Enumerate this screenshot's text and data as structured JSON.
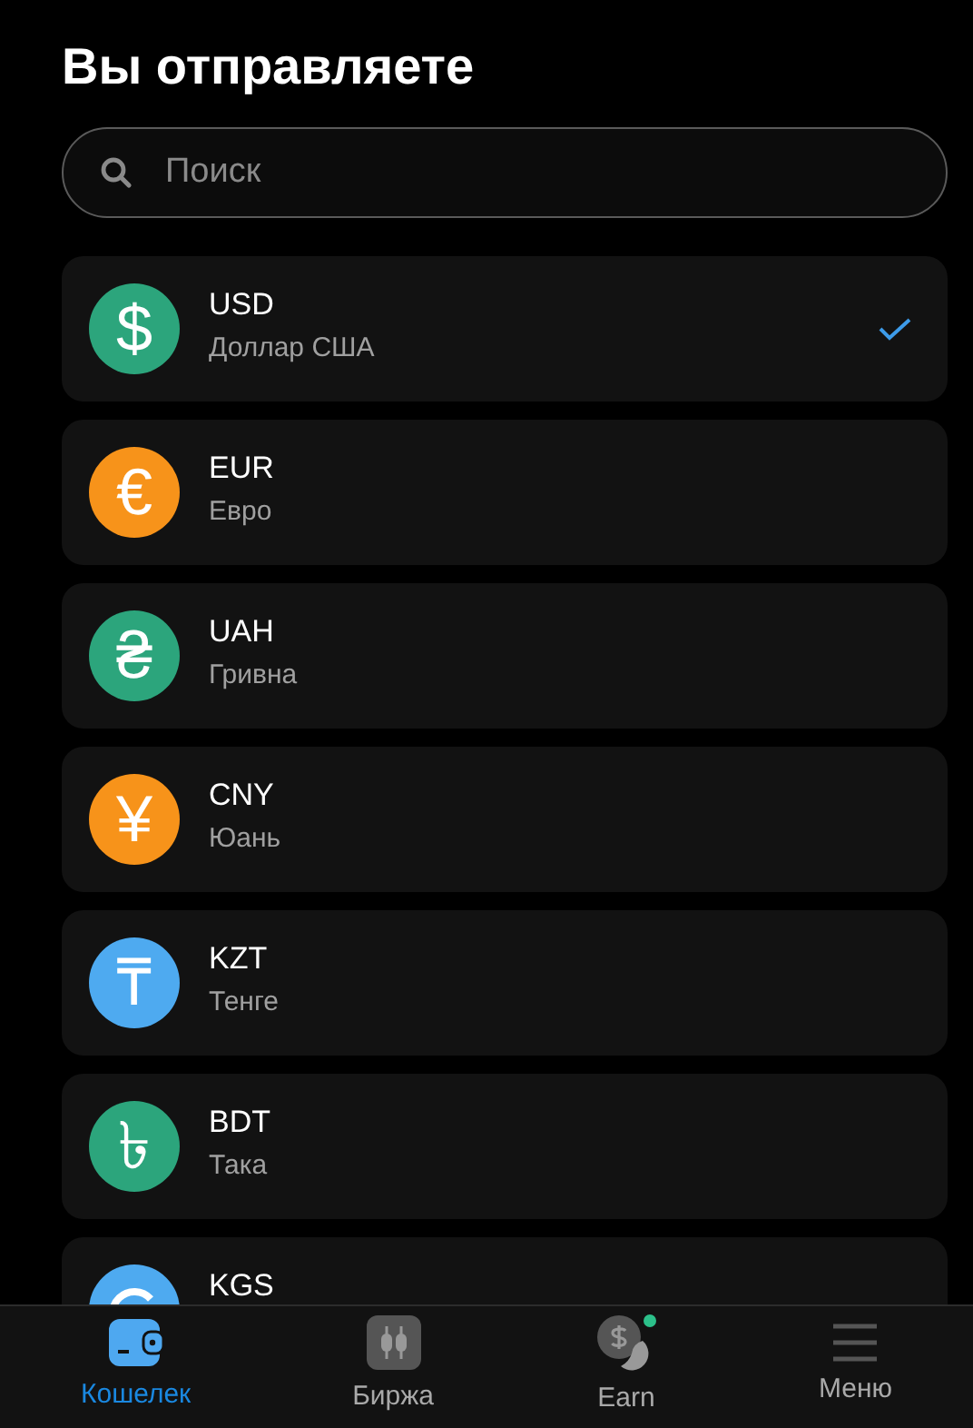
{
  "title": "Вы отправляете",
  "search": {
    "placeholder": "Поиск"
  },
  "currencies": [
    {
      "code": "USD",
      "name": "Доллар США",
      "symbol": "$",
      "color": "#2ca57c",
      "selected": true
    },
    {
      "code": "EUR",
      "name": "Евро",
      "symbol": "€",
      "color": "#f7931a",
      "selected": false
    },
    {
      "code": "UAH",
      "name": "Гривна",
      "symbol": "₴",
      "color": "#2ca57c",
      "selected": false
    },
    {
      "code": "CNY",
      "name": "Юань",
      "symbol": "¥",
      "color": "#f7931a",
      "selected": false
    },
    {
      "code": "KZT",
      "name": "Тенге",
      "symbol": "₸",
      "color": "#4eaaf0",
      "selected": false
    },
    {
      "code": "BDT",
      "name": "Така",
      "symbol": "৳",
      "color": "#2ca57c",
      "selected": false
    },
    {
      "code": "KGS",
      "color": "#4eaaf0",
      "selected": false
    }
  ],
  "nav": [
    {
      "kind": "wallet",
      "label": "Кошелек",
      "selected": true
    },
    {
      "kind": "exchange",
      "label": "Биржа",
      "selected": false
    },
    {
      "kind": "earn",
      "label": "Earn",
      "selected": false
    },
    {
      "kind": "menu",
      "label": "Меню",
      "selected": false
    }
  ]
}
